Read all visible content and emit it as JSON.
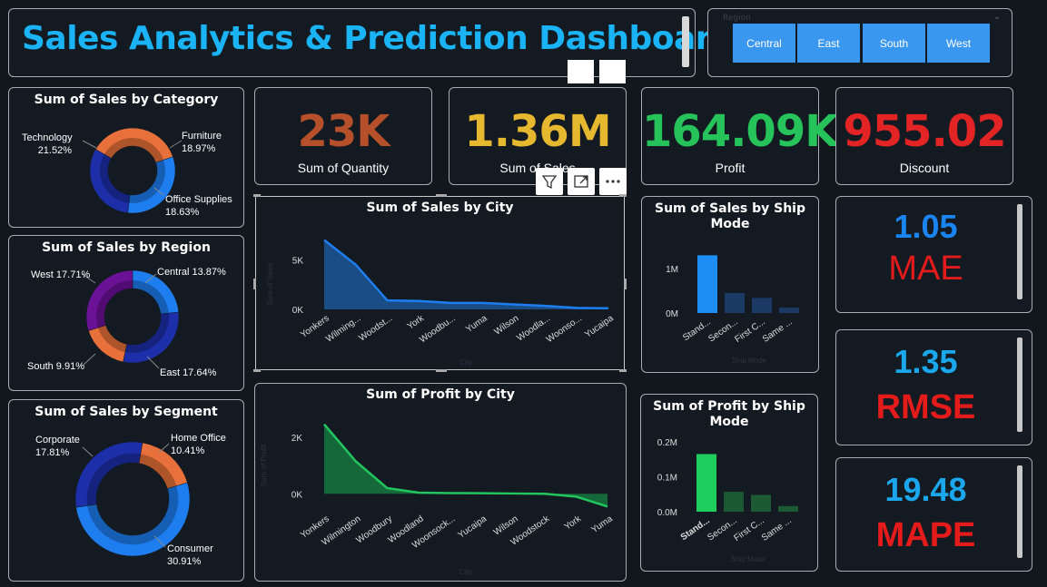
{
  "title": "Sales Analytics & Prediction Dashboard",
  "slicer": {
    "label": "Region",
    "options": [
      "Central",
      "East",
      "South",
      "West"
    ]
  },
  "kpis": {
    "quantity": {
      "value": "23K",
      "label": "Sum of Quantity",
      "color": "#b5502a"
    },
    "sales": {
      "value": "1.36M",
      "label": "Sum of Sales",
      "color": "#e6b830"
    },
    "profit": {
      "value": "164.09K",
      "label": "Profit",
      "color": "#25c35a"
    },
    "discount": {
      "value": "955.02",
      "label": "Discount",
      "color": "#e32424"
    }
  },
  "metrics": {
    "mae": {
      "value": "1.05",
      "label": "MAE",
      "value_color": "#1a84f0"
    },
    "rmse": {
      "value": "1.35",
      "label": "RMSE"
    },
    "mape": {
      "value": "19.48",
      "label": "MAPE"
    }
  },
  "category_chart": {
    "title": "Sum of Sales by Category",
    "labels": {
      "technology": [
        "Technology",
        "21.52%"
      ],
      "furniture": [
        "Furniture",
        "18.97%"
      ],
      "office": [
        "Office Supplies",
        "18.63%"
      ]
    }
  },
  "region_chart": {
    "title": "Sum of Sales by Region",
    "labels": {
      "west": "West 17.71%",
      "central": "Central 13.87%",
      "south": "South 9.91%",
      "east": "East 17.64%"
    }
  },
  "segment_chart": {
    "title": "Sum of Sales by Segment",
    "labels": {
      "corporate": [
        "Corporate",
        "17.81%"
      ],
      "home": [
        "Home Office",
        "10.41%"
      ],
      "consumer": [
        "Consumer",
        "30.91%"
      ]
    }
  },
  "sales_city": {
    "title": "Sum of Sales by City",
    "y_ticks": [
      "5K",
      "0K"
    ],
    "xlabel": "City",
    "ylabel": "Sum of Sales"
  },
  "profit_city": {
    "title": "Sum of Profit by City",
    "y_ticks": [
      "2K",
      "0K"
    ],
    "xlabel": "City",
    "ylabel": "Sum of Profit"
  },
  "ship_sales": {
    "title_line1": "Sum of Sales by Ship",
    "title_line2": "Mode",
    "y_ticks": [
      "1M",
      "0M"
    ],
    "xlabel": "Ship Mode"
  },
  "ship_profit": {
    "title_line1": "Sum of Profit by Ship",
    "title_line2": "Mode",
    "y_ticks": [
      "0.2M",
      "0.1M",
      "0.0M"
    ],
    "xlabel": "Ship Mode"
  },
  "chart_data": [
    {
      "type": "pie",
      "title": "Sum of Sales by Category",
      "slices": [
        {
          "label": "Technology",
          "value": 21.52,
          "color": "#e8703a"
        },
        {
          "label": "Furniture",
          "value": 18.97,
          "color": "#1e7ef0"
        },
        {
          "label": "Office Supplies",
          "value": 18.63,
          "color": "#1c2fa8"
        }
      ]
    },
    {
      "type": "pie",
      "title": "Sum of Sales by Region",
      "slices": [
        {
          "label": "Central",
          "value": 13.87,
          "color": "#1e7ef0"
        },
        {
          "label": "East",
          "value": 17.64,
          "color": "#1c2fa8"
        },
        {
          "label": "South",
          "value": 9.91,
          "color": "#e8703a"
        },
        {
          "label": "West",
          "value": 17.71,
          "color": "#6b1196"
        }
      ]
    },
    {
      "type": "pie",
      "title": "Sum of Sales by Segment",
      "slices": [
        {
          "label": "Home Office",
          "value": 10.41,
          "color": "#e8703a"
        },
        {
          "label": "Consumer",
          "value": 30.91,
          "color": "#1e7ef0"
        },
        {
          "label": "Corporate",
          "value": 17.81,
          "color": "#1c2fa8"
        }
      ]
    },
    {
      "type": "area",
      "title": "Sum of Sales by City",
      "xlabel": "City",
      "categories": [
        "Yonkers",
        "Wilming...",
        "Woodst...",
        "York",
        "Woodbu...",
        "Yuma",
        "Wilson",
        "Woodla...",
        "Woonso...",
        "Yucaipa"
      ],
      "values": [
        7000,
        4500,
        900,
        850,
        650,
        650,
        500,
        350,
        150,
        120
      ],
      "ylim": [
        0,
        7500
      ],
      "ticks": [
        0,
        5000
      ]
    },
    {
      "type": "area",
      "title": "Sum of Profit by City",
      "xlabel": "City",
      "categories": [
        "Yonkers",
        "Wilmington",
        "Woodbury",
        "Woodland",
        "Woonsock...",
        "Yucaipa",
        "Wilson",
        "Woodstock",
        "York",
        "Yuma"
      ],
      "values": [
        2450,
        1150,
        200,
        40,
        25,
        20,
        10,
        0,
        -100,
        -450
      ],
      "ylim": [
        -600,
        2600
      ],
      "ticks": [
        0,
        2000
      ]
    },
    {
      "type": "bar",
      "title": "Sum of Sales by Ship Mode",
      "xlabel": "Ship Mode",
      "categories": [
        "Stand...",
        "Secon...",
        "First C...",
        "Same ..."
      ],
      "values": [
        1300000,
        450000,
        340000,
        120000
      ],
      "ylim": [
        0,
        1450000
      ]
    },
    {
      "type": "bar",
      "title": "Sum of Profit by Ship Mode",
      "xlabel": "Ship Mode",
      "categories": [
        "Stand...",
        "Secon...",
        "First C...",
        "Same ..."
      ],
      "values": [
        165000,
        57000,
        48000,
        16000
      ],
      "ylim": [
        0,
        200000
      ]
    }
  ]
}
